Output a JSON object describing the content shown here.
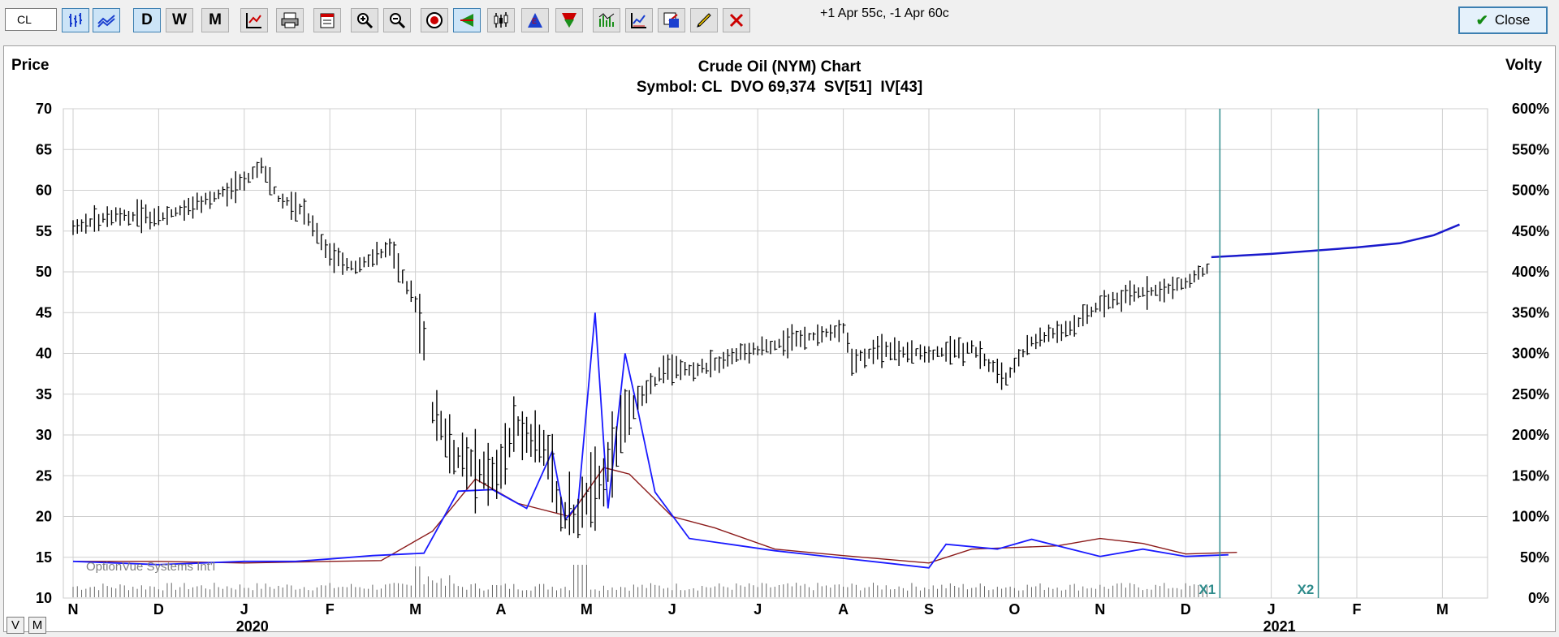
{
  "toolbar": {
    "symbol_value": "CL",
    "buttons": [
      {
        "name": "bar-chart-icon",
        "active": true
      },
      {
        "name": "line-chart-icon",
        "active": true
      },
      {
        "name": "daily-button",
        "label": "D",
        "active": true
      },
      {
        "name": "weekly-button",
        "label": "W",
        "active": false
      },
      {
        "name": "monthly-button",
        "label": "M",
        "active": false
      }
    ],
    "notes": "+1 Apr 55c, -1 Apr 60c",
    "close_label": "Close"
  },
  "chart": {
    "title": "Crude Oil (NYM) Chart",
    "subtitle": "Symbol: CL  DVO 69,374  SV[51]  IV[43]",
    "left_axis_label": "Price",
    "right_axis_label": "Volty",
    "watermark": "OptionVue Systems Int'l",
    "x1_label": "X1",
    "x2_label": "X2",
    "view_buttons": [
      "V",
      "M"
    ],
    "colors": {
      "price": "#000000",
      "iv": "#1a1aff",
      "sv": "#8b1a1a",
      "zone_up": "#33ee33",
      "zone_down": "#ff9a9a",
      "marker": "#2e8b8b"
    }
  },
  "chart_data": {
    "type": "line",
    "y_left": {
      "label": "Price",
      "ylim": [
        10,
        70
      ],
      "ticks": [
        "70",
        "65",
        "60",
        "55",
        "50",
        "45",
        "40",
        "35",
        "30",
        "25",
        "20",
        "15",
        "10"
      ]
    },
    "y_right": {
      "label": "Volty",
      "ylim": [
        0,
        600
      ],
      "ticks": [
        "600%",
        "550%",
        "500%",
        "450%",
        "400%",
        "350%",
        "300%",
        "250%",
        "200%",
        "150%",
        "100%",
        "50%",
        "0%"
      ]
    },
    "x_months": [
      "N",
      "D",
      "J",
      "F",
      "M",
      "A",
      "M",
      "J",
      "J",
      "A",
      "S",
      "O",
      "N",
      "D",
      "J",
      "F",
      "M"
    ],
    "x_years": [
      {
        "label": "2020",
        "month_index": 2
      },
      {
        "label": "2021",
        "month_index": 14
      }
    ],
    "series": [
      {
        "name": "Price",
        "values": [
          [
            0,
            55.5
          ],
          [
            0.5,
            57
          ],
          [
            1,
            56.5
          ],
          [
            1.5,
            58.5
          ],
          [
            2,
            61
          ],
          [
            2.2,
            63
          ],
          [
            2.4,
            59
          ],
          [
            2.7,
            57.5
          ],
          [
            3,
            52
          ],
          [
            3.3,
            50.5
          ],
          [
            3.7,
            53
          ],
          [
            4,
            46
          ],
          [
            4.1,
            41.5
          ],
          [
            4.2,
            33
          ],
          [
            4.5,
            27
          ],
          [
            4.9,
            25
          ],
          [
            5.2,
            31
          ],
          [
            5.5,
            29
          ],
          [
            5.7,
            20
          ],
          [
            5.9,
            20
          ],
          [
            6.2,
            25
          ],
          [
            6.5,
            33
          ],
          [
            6.9,
            38
          ],
          [
            7.3,
            38
          ],
          [
            7.8,
            40
          ],
          [
            8.4,
            41.5
          ],
          [
            9,
            43
          ],
          [
            9.1,
            39
          ],
          [
            9.4,
            40.5
          ],
          [
            10,
            40
          ],
          [
            10.5,
            40.5
          ],
          [
            10.9,
            37
          ],
          [
            11.2,
            41.5
          ],
          [
            11.7,
            43.5
          ],
          [
            12,
            46
          ],
          [
            12.5,
            47.5
          ],
          [
            13,
            48.5
          ],
          [
            13.3,
            51
          ]
        ]
      },
      {
        "name": "IV",
        "values": [
          [
            0,
            45
          ],
          [
            1,
            41
          ],
          [
            2,
            45
          ],
          [
            2.6,
            45
          ],
          [
            3,
            48
          ],
          [
            3.5,
            52
          ],
          [
            4.1,
            55
          ],
          [
            4.5,
            131
          ],
          [
            4.9,
            133
          ],
          [
            5.3,
            110
          ],
          [
            5.6,
            180
          ],
          [
            5.75,
            96
          ],
          [
            5.9,
            115
          ],
          [
            6.1,
            350
          ],
          [
            6.25,
            110
          ],
          [
            6.45,
            300
          ],
          [
            6.6,
            230
          ],
          [
            6.8,
            130
          ],
          [
            7.2,
            73
          ],
          [
            8.2,
            58
          ],
          [
            9.5,
            43
          ],
          [
            10,
            37
          ],
          [
            10.2,
            66
          ],
          [
            10.8,
            60
          ],
          [
            11.2,
            72
          ],
          [
            12,
            51
          ],
          [
            12.5,
            60
          ],
          [
            13,
            51
          ],
          [
            13.5,
            53
          ]
        ]
      },
      {
        "name": "SV",
        "values": [
          [
            0,
            45
          ],
          [
            1,
            45
          ],
          [
            2,
            43
          ],
          [
            3,
            45
          ],
          [
            3.6,
            46
          ],
          [
            4.2,
            82
          ],
          [
            4.7,
            146
          ],
          [
            5.2,
            116
          ],
          [
            5.8,
            100
          ],
          [
            6.2,
            160
          ],
          [
            6.5,
            152
          ],
          [
            7,
            100
          ],
          [
            7.5,
            86
          ],
          [
            8.2,
            60
          ],
          [
            9,
            52
          ],
          [
            10,
            43
          ],
          [
            10.5,
            60
          ],
          [
            11,
            62
          ],
          [
            11.5,
            64
          ],
          [
            12,
            73
          ],
          [
            12.5,
            67
          ],
          [
            13,
            54
          ],
          [
            13.6,
            56
          ]
        ]
      },
      {
        "name": "Projected",
        "values": [
          [
            13.3,
            51.8
          ],
          [
            14,
            52.2
          ],
          [
            15,
            53
          ],
          [
            15.5,
            53.5
          ],
          [
            15.9,
            54.5
          ],
          [
            16.2,
            55.8
          ]
        ]
      }
    ],
    "markers": [
      {
        "label": "X1",
        "x": 13.4
      },
      {
        "label": "X2",
        "x": 14.55
      }
    ],
    "grid": true
  }
}
